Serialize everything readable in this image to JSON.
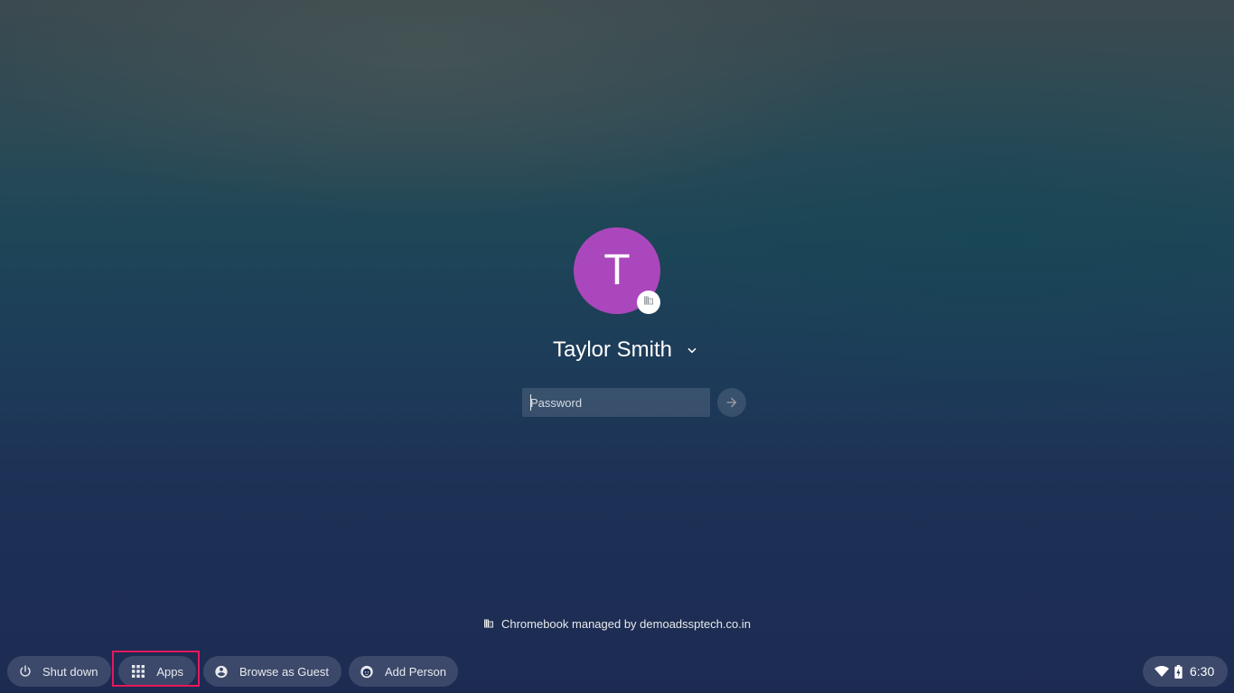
{
  "user": {
    "initial": "T",
    "name": "Taylor Smith",
    "avatar_color": "#ab47bc",
    "badge_icon": "business-icon"
  },
  "password": {
    "placeholder": "Password",
    "value": "",
    "submit_icon": "arrow-right-icon"
  },
  "managed_notice": {
    "icon": "business-icon",
    "text": "Chromebook managed by demoadssptech.co.in"
  },
  "shelf": {
    "shutdown": {
      "label": "Shut down",
      "icon": "power-icon"
    },
    "apps": {
      "label": "Apps",
      "icon": "apps-grid-icon",
      "highlight_color": "#e8175d"
    },
    "guest": {
      "label": "Browse as Guest",
      "icon": "account-circle-icon"
    },
    "add_person": {
      "label": "Add Person",
      "icon": "add-person-icon"
    }
  },
  "status": {
    "time": "6:30",
    "wifi_icon": "wifi-icon",
    "battery_icon": "battery-charging-icon"
  }
}
